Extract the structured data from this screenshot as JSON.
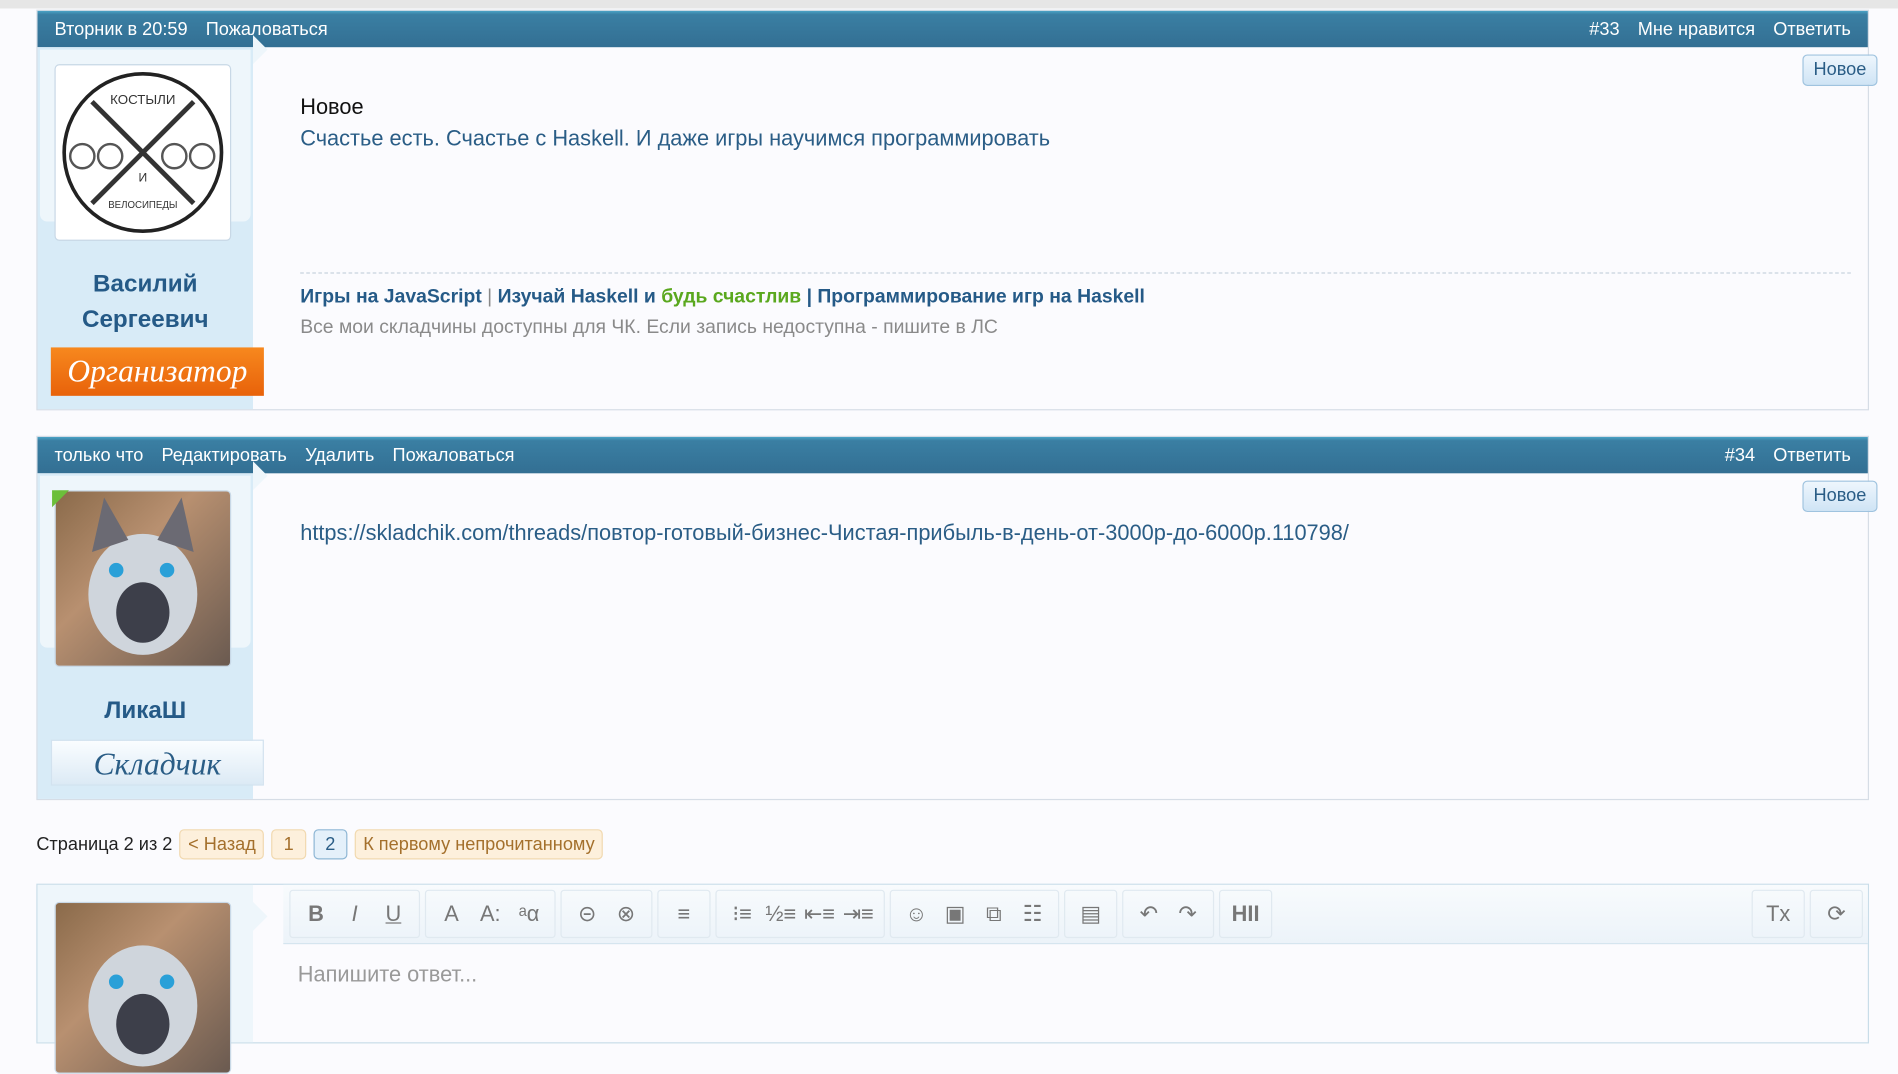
{
  "posts": [
    {
      "date": "Вторник в 20:59",
      "actions_left": [
        "Пожаловаться"
      ],
      "number": "#33",
      "actions_right": [
        "Мне нравится",
        "Ответить"
      ],
      "author": {
        "name_line1": "Василий",
        "name_line2": "Сергеевич",
        "role": "Организатор",
        "avatar_text": [
          "КОСТЫЛИ",
          "И",
          "ВЕЛОСИПЕДЫ"
        ]
      },
      "new_badge": "Новое",
      "body_line1": "Новое",
      "body_line2": "Счастье есть. Счастье с Haskell. И даже игры научимся программировать",
      "signature": {
        "link1": "Игры на JavaScript",
        "sep1": " | ",
        "link2": "Изучай Haskell и ",
        "link3": "будь счастлив",
        "sep2": " | ",
        "link4": "Программирование игр на Haskell",
        "note": "Все мои складчины доступны для ЧК. Если запись недоступна - пишите в ЛС"
      }
    },
    {
      "date": "только что",
      "actions_left": [
        "Редактировать",
        "Удалить",
        "Пожаловаться"
      ],
      "number": "#34",
      "actions_right": [
        "Ответить"
      ],
      "author": {
        "name": "ЛикаШ",
        "role": "Складчик"
      },
      "new_badge": "Новое",
      "body_link": "https://skladchik.com/threads/повтор-готовый-бизнес-Чистая-прибыль-в-день-от-3000р-до-6000р.110798/"
    }
  ],
  "pagination": {
    "label": "Страница 2 из 2",
    "prev": "< Назад",
    "pages": [
      "1",
      "2"
    ],
    "first_unread": "К первому непрочитанному"
  },
  "editor": {
    "placeholder": "Напишите ответ...",
    "toolbar": [
      [
        "B",
        "I",
        "U"
      ],
      [
        "A",
        "A:",
        "ᵃα"
      ],
      [
        "⊝",
        "⊗"
      ],
      [
        "≡"
      ],
      [
        "⁝≡",
        "½≡",
        "⇤≡",
        "⇥≡"
      ],
      [
        "☺",
        "▣",
        "⧉",
        "☷"
      ],
      [
        "▤"
      ],
      [
        "↶",
        "↷"
      ],
      [
        "HII"
      ]
    ],
    "toolbar_right": [
      "Tx",
      "⟳"
    ]
  }
}
